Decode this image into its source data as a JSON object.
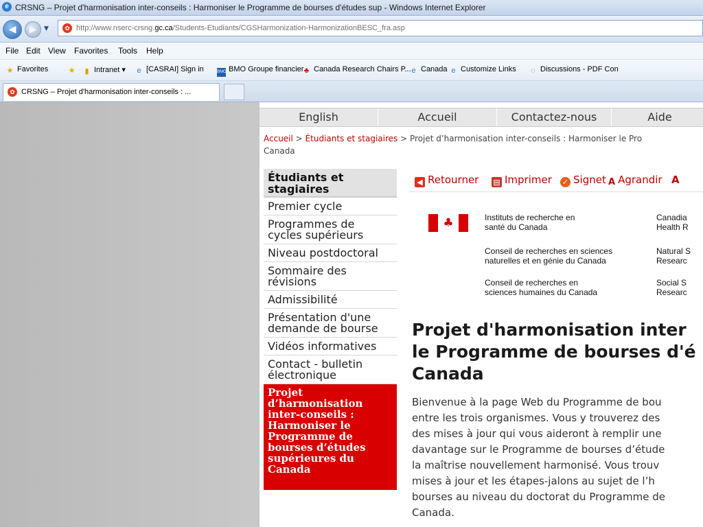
{
  "browser": {
    "window_title": "CRSNG – Projet d'harmonisation inter-conseils : Harmoniser le Programme de bourses d'études sup - Windows Internet Explorer",
    "url_prefix": "http://www.nserc-crsng.",
    "url_domain": "gc.ca",
    "url_path": "/Students-Etudiants/CGSHarmonization-HarmonizationBESC_fra.asp",
    "menu": [
      "File",
      "Edit",
      "View",
      "Favorites",
      "Tools",
      "Help"
    ],
    "favorites": [
      "Favorites",
      "Intranet ▾",
      "[CASRAI] Sign in",
      "BMO Groupe financier",
      "Canada Research Chairs P...",
      "Canada",
      "Customize Links",
      "Discussions - PDF Con"
    ],
    "tab_title": "CRSNG – Projet d'harmonisation inter-conseils : ..."
  },
  "page": {
    "topnav": [
      "English",
      "Accueil",
      "Contactez-nous",
      "Aide"
    ],
    "breadcrumb": {
      "home": "Accueil",
      "sep": " > ",
      "section": "Étudiants et stagiaires",
      "current": "Projet d’harmonisation inter-conseils : Harmoniser le Pro",
      "current_line2": "Canada"
    },
    "leftnav": {
      "heading_l1": "Étudiants et",
      "heading_l2": "stagiaires",
      "items": [
        [
          "Premier cycle"
        ],
        [
          "Programmes de",
          "cycles supérieurs"
        ],
        [
          "Niveau postdoctoral"
        ],
        [
          "Sommaire des",
          "révisions"
        ],
        [
          "Admissibilité"
        ],
        [
          "Présentation d'une",
          "demande de bourse"
        ],
        [
          "Vidéos informatives"
        ],
        [
          "Contact - bulletin",
          "électronique"
        ]
      ],
      "active_lines": [
        "Projet",
        "d’harmonisation",
        "inter-conseils :",
        "Harmoniser le",
        "Programme de",
        "bourses d’études",
        "supérieures du",
        "Canada"
      ]
    },
    "toolbar": [
      "Retourner",
      "Imprimer",
      "Signet",
      "Agrandir",
      "A"
    ],
    "agencies_fr": [
      [
        "Instituts de recherche en",
        "santé du Canada"
      ],
      [
        "Conseil de recherches en sciences",
        "naturelles et en génie du Canada"
      ],
      [
        "Conseil de recherches en",
        "sciences humaines du Canada"
      ]
    ],
    "agencies_en": [
      [
        "Canadia",
        "Health R"
      ],
      [
        "Natural S",
        "Researc"
      ],
      [
        "Social S",
        "Researc"
      ]
    ],
    "title_lines": [
      "Projet d'harmonisation inter",
      "le Programme de bourses d'é",
      "Canada"
    ],
    "body_lines": [
      "Bienvenue à la page Web du Programme de bou",
      "entre les trois organismes. Vous y trouverez des",
      "des mises à jour qui vous aideront à remplir une",
      "davantage sur le Programme de bourses d’étude",
      "la maîtrise nouvellement harmonisé. Vous trouv",
      "mises à jour et les étapes-jalons au sujet de l’h",
      "bourses au niveau du doctorat du Programme de",
      "Canada."
    ]
  }
}
